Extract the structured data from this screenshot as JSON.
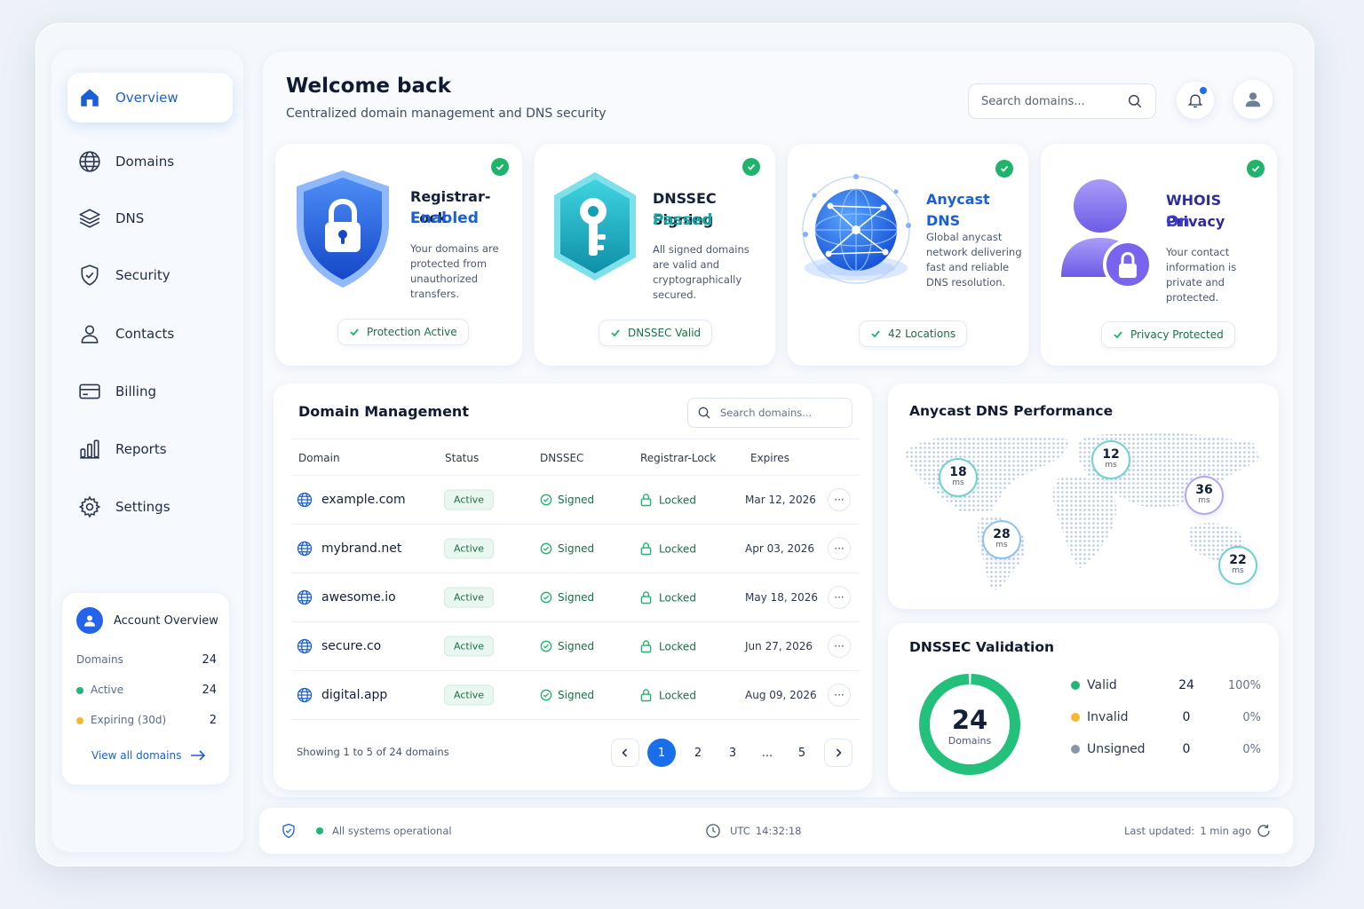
{
  "sidebar": {
    "items": [
      {
        "label": "Overview",
        "icon": "home-icon"
      },
      {
        "label": "Domains",
        "icon": "globe-icon"
      },
      {
        "label": "DNS",
        "icon": "layers-icon"
      },
      {
        "label": "Security",
        "icon": "shield-icon"
      },
      {
        "label": "Contacts",
        "icon": "person-icon"
      },
      {
        "label": "Billing",
        "icon": "card-icon"
      },
      {
        "label": "Reports",
        "icon": "bar-chart-icon"
      },
      {
        "label": "Settings",
        "icon": "gear-icon"
      }
    ],
    "account": {
      "title": "Account Overview",
      "rows": [
        {
          "label": "Domains",
          "value": "24"
        },
        {
          "label": "Active",
          "value": "24"
        },
        {
          "label": "Expiring (30d)",
          "value": "2"
        }
      ],
      "view_all": "View all domains"
    }
  },
  "header": {
    "title": "Welcome back",
    "subtitle": "Centralized domain management and DNS security",
    "search_placeholder": "Search domains..."
  },
  "cards": [
    {
      "title": "Registrar-Lock",
      "status": "Enabled",
      "desc": "Your domains are protected from unauthorized transfers.",
      "button": "Protection Active"
    },
    {
      "title": "DNSSEC Signing",
      "status": "Passed",
      "desc": "All signed domains are valid and cryptographically secured.",
      "button": "DNSSEC Valid"
    },
    {
      "title": "Anycast DNS",
      "status": "",
      "desc": "Global anycast network delivering fast and reliable DNS resolution.",
      "button": "42 Locations"
    },
    {
      "title": "WHOIS Privacy",
      "status": "On",
      "desc": "Your contact information is private and protected.",
      "button": "Privacy Protected"
    }
  ],
  "domain_table": {
    "title": "Domain Management",
    "search_placeholder": "Search domains...",
    "columns": [
      "Domain",
      "Status",
      "DNSSEC",
      "Registrar-Lock",
      "Expires"
    ],
    "rows": [
      {
        "domain": "example.com",
        "status": "Active",
        "dnssec": "Signed",
        "lock": "Locked",
        "expires": "Mar 12, 2026"
      },
      {
        "domain": "mybrand.net",
        "status": "Active",
        "dnssec": "Signed",
        "lock": "Locked",
        "expires": "Apr 03, 2026"
      },
      {
        "domain": "awesome.io",
        "status": "Active",
        "dnssec": "Signed",
        "lock": "Locked",
        "expires": "May 18, 2026"
      },
      {
        "domain": "secure.co",
        "status": "Active",
        "dnssec": "Signed",
        "lock": "Locked",
        "expires": "Jun 27, 2026"
      },
      {
        "domain": "digital.app",
        "status": "Active",
        "dnssec": "Signed",
        "lock": "Locked",
        "expires": "Aug 09, 2026"
      }
    ],
    "showing": "Showing 1 to 5 of 24 domains",
    "pages": [
      "1",
      "2",
      "3",
      "...",
      "5"
    ],
    "current_page": "1",
    "more_glyph": "···"
  },
  "performance": {
    "title": "Anycast DNS Performance",
    "unit": "ms",
    "latencies": [
      "18",
      "12",
      "36",
      "28",
      "22"
    ]
  },
  "dnssec_validation": {
    "title": "DNSSEC Validation",
    "total": "24",
    "total_label": "Domains",
    "rows": [
      {
        "label": "Valid",
        "count": "24",
        "pct": "100%",
        "color": "#22b573"
      },
      {
        "label": "Invalid",
        "count": "0",
        "pct": "0%",
        "color": "#f5b82e"
      },
      {
        "label": "Unsigned",
        "count": "0",
        "pct": "0%",
        "color": "#8a96a8"
      }
    ]
  },
  "footer": {
    "status": "All systems operational",
    "utc_label": "UTC",
    "time": "14:32:18",
    "last_updated_label": "Last updated:",
    "last_updated": "1 min ago"
  },
  "colors": {
    "accent": "#1a6fe8",
    "success": "#1fb46b",
    "warning": "#f5b82e",
    "purple": "#6c5ce7"
  }
}
